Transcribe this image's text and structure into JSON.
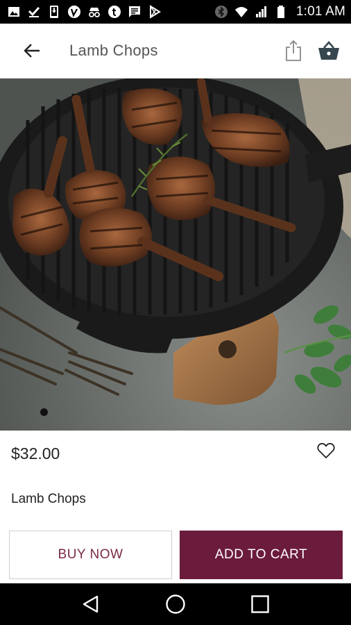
{
  "status_bar": {
    "time": "1:01 AM",
    "left_icons": [
      "gallery-icon",
      "download-done-icon",
      "phone-download-icon",
      "vine-icon",
      "incognito-icon",
      "tumblr-icon",
      "message-icon",
      "play-store-icon"
    ],
    "right_icons": [
      "bluetooth-icon",
      "wifi-icon",
      "signal-icon",
      "battery-icon"
    ]
  },
  "app_bar": {
    "title": "Lamb Chops",
    "back_icon": "arrow-back-icon",
    "share_icon": "share-icon",
    "cart_icon": "basket-icon"
  },
  "product": {
    "image_description_icon": "lamb-chops-photo",
    "price": "$32.00",
    "name": "Lamb Chops",
    "favorite_icon": "heart-outline-icon"
  },
  "actions": {
    "buy_now_label": "BUY NOW",
    "add_to_cart_label": "ADD TO CART"
  },
  "colors": {
    "accent": "#6b1b3c",
    "icon": "#37474f"
  }
}
